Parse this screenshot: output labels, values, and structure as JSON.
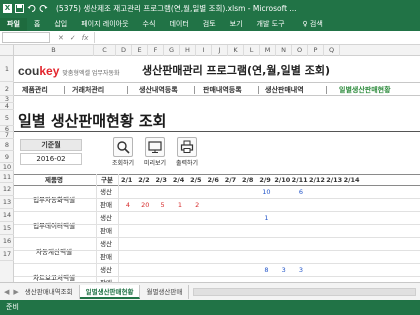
{
  "window": {
    "title": "(5375) 생산제조 재고관리 프로그램(연,월,일별 조회).xlsm - Microsoft ...",
    "app_icon": "X"
  },
  "ribbon": {
    "tabs": [
      "파일",
      "홈",
      "삽입",
      "페이지 레이아웃",
      "수식",
      "데이터",
      "검토",
      "보기",
      "개발 도구",
      "♀ 검색"
    ]
  },
  "column_headers": [
    "B",
    "C",
    "D",
    "E",
    "F",
    "G",
    "H",
    "I",
    "J",
    "K",
    "L",
    "M",
    "N",
    "O",
    "P",
    "Q"
  ],
  "row_headers": [
    "1",
    "2",
    "3",
    "4",
    "5",
    "6",
    "7",
    "8",
    "9",
    "10",
    "11",
    "12",
    "13",
    "14",
    "15",
    "16",
    "17"
  ],
  "brand": {
    "logo_prefix": "cou",
    "logo_suffix": "key",
    "tagline": "맞춤형엑셀 업무자동화"
  },
  "app_title": "생산판매관리 프로그램(연,월,일별 조회)",
  "menu": [
    "제품관리",
    "거래처관리",
    "생산내역등록",
    "판매내역등록",
    "생산판매내역",
    "일별생산판매현황"
  ],
  "page_title": "일별 생산판매현황 조회",
  "base_month": {
    "label": "기준월",
    "value": "2016-02"
  },
  "toolbar": {
    "search": "조회하기",
    "preview": "미리보기",
    "print": "출력하기"
  },
  "table": {
    "headers": {
      "product": "제품명",
      "kind": "구분"
    },
    "dates": [
      "2/1",
      "2/2",
      "2/3",
      "2/4",
      "2/5",
      "2/6",
      "2/7",
      "2/8",
      "2/9",
      "2/10",
      "2/11",
      "2/12",
      "2/13",
      "2/14"
    ],
    "products": [
      {
        "name": "업무자동화엑셀",
        "rows": [
          {
            "kind": "생산",
            "values": [
              "",
              "",
              "",
              "",
              "",
              "",
              "",
              "",
              "10",
              "",
              "6",
              "",
              "",
              ""
            ]
          },
          {
            "kind": "판매",
            "values": [
              "4",
              "20",
              "5",
              "1",
              "2",
              "",
              "",
              "",
              "",
              "",
              "",
              "",
              "",
              ""
            ]
          }
        ]
      },
      {
        "name": "업무데이터엑셀",
        "rows": [
          {
            "kind": "생산",
            "values": [
              "",
              "",
              "",
              "",
              "",
              "",
              "",
              "",
              "1",
              "",
              "",
              "",
              "",
              ""
            ]
          },
          {
            "kind": "판매",
            "values": [
              "",
              "",
              "",
              "",
              "",
              "",
              "",
              "",
              "",
              "",
              "",
              "",
              "",
              ""
            ]
          }
        ]
      },
      {
        "name": "자동계산엑셀",
        "rows": [
          {
            "kind": "생산",
            "values": [
              "",
              "",
              "",
              "",
              "",
              "",
              "",
              "",
              "",
              "",
              "",
              "",
              "",
              ""
            ]
          },
          {
            "kind": "판매",
            "values": [
              "",
              "",
              "",
              "",
              "",
              "",
              "",
              "",
              "",
              "",
              "",
              "",
              "",
              ""
            ]
          }
        ]
      },
      {
        "name": "차트보고서엑셀",
        "rows": [
          {
            "kind": "생산",
            "values": [
              "",
              "",
              "",
              "",
              "",
              "",
              "",
              "",
              "8",
              "3",
              "3",
              "",
              "",
              ""
            ]
          },
          {
            "kind": "판매",
            "values": [
              "",
              "",
              "",
              "",
              "",
              "",
              "",
              "",
              "",
              "",
              "",
              "",
              "",
              ""
            ]
          }
        ]
      }
    ]
  },
  "sheet_tabs": [
    "생산판매내역조회",
    "일별생산판매현황",
    "월별생산판매"
  ],
  "active_sheet": 1,
  "status": "준비",
  "colors": {
    "excel_green": "#217346",
    "sale_red": "#d62b2b",
    "prod_blue": "#2355c9",
    "menu_active": "#2e8b3d"
  }
}
